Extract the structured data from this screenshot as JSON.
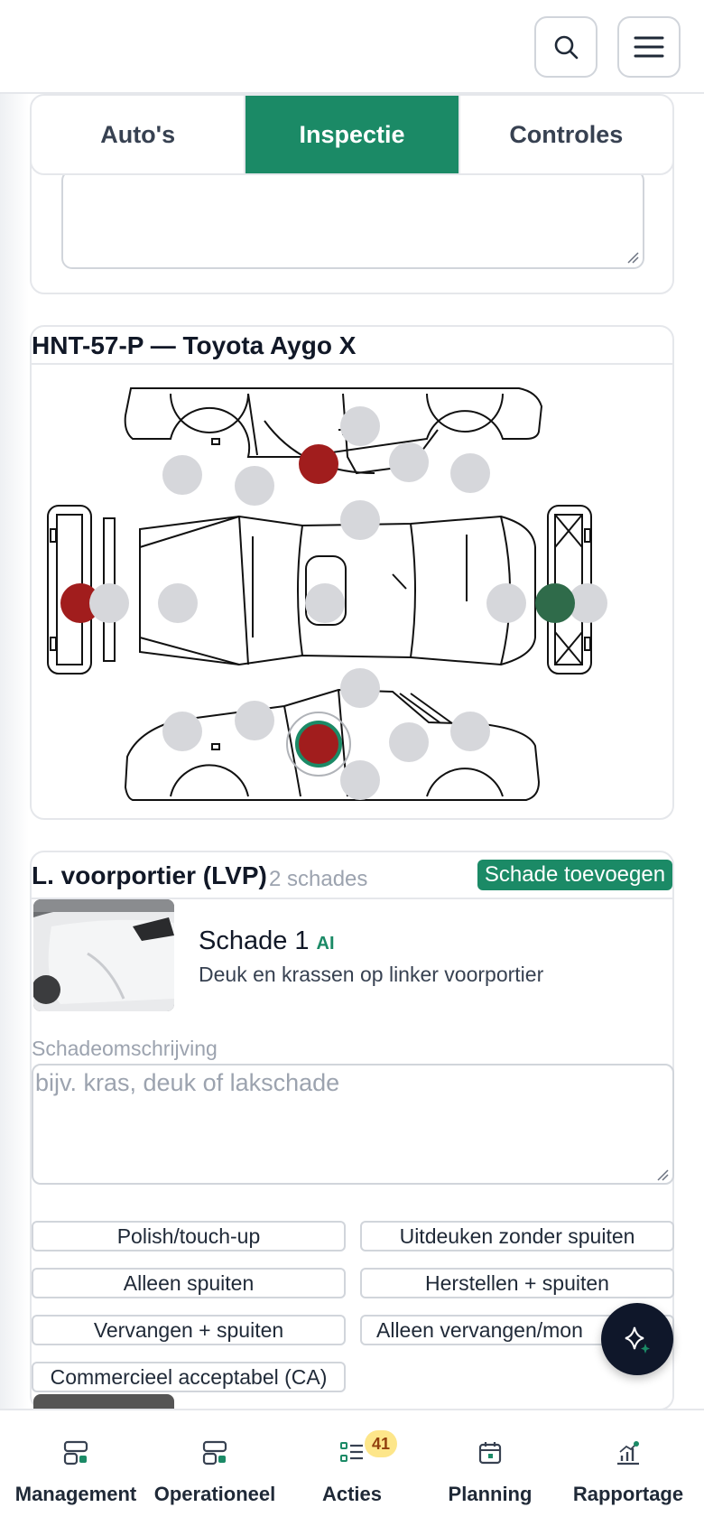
{
  "header": {
    "search_icon": "search-icon",
    "menu_icon": "hamburger-menu-icon"
  },
  "tabs": [
    {
      "label": "Auto's",
      "active": false
    },
    {
      "label": "Inspectie",
      "active": true
    },
    {
      "label": "Controles",
      "active": false
    }
  ],
  "vehicle": {
    "title": "HNT-57-P — Toyota Aygo X"
  },
  "colors": {
    "accent": "#1b8a66",
    "damage_marker": "#a11d1d",
    "ok_marker": "#2f6b4a",
    "empty_marker": "#d6d7db"
  },
  "markers": {
    "count_total": 24,
    "damage_count": 3,
    "ok_count": 1
  },
  "damage_panel": {
    "title": "L. voorportier (LVP)",
    "count": "2 schades",
    "add_button": "Schade toevoegen",
    "damage_name": "Schade 1",
    "ai_label": "AI",
    "damage_description": "Deuk en krassen op linker voorportier",
    "desc_label": "Schadeomschrijving",
    "desc_placeholder": "bijv. kras, deuk of lakschade",
    "repair_options": [
      "Polish/touch-up",
      "Uitdeuken zonder spuiten",
      "Alleen spuiten",
      "Herstellen + spuiten",
      "Vervangen + spuiten",
      "Alleen vervangen/mon",
      "Commercieel acceptabel (CA)"
    ]
  },
  "fab": {
    "icon": "sparkle-icon"
  },
  "nav": [
    {
      "label": "Management",
      "icon": "dashboard-icon"
    },
    {
      "label": "Operationeel",
      "icon": "dashboard-icon"
    },
    {
      "label": "Acties",
      "icon": "list-icon",
      "badge": "41"
    },
    {
      "label": "Planning",
      "icon": "calendar-icon"
    },
    {
      "label": "Rapportage",
      "icon": "chart-icon"
    }
  ]
}
